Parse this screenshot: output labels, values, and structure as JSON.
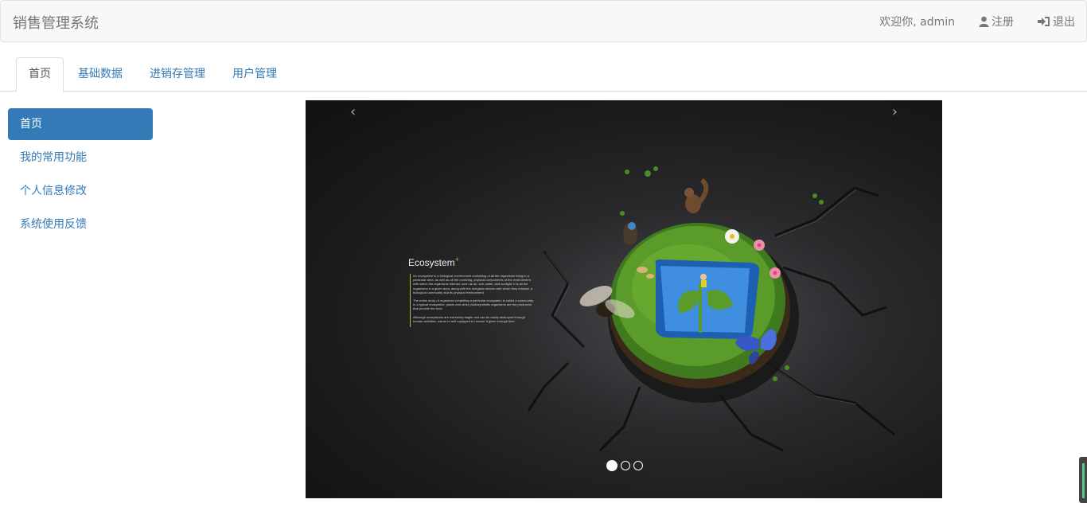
{
  "navbar": {
    "brand": "销售管理系统",
    "welcome": "欢迎你, admin",
    "register_label": "注册",
    "logout_label": "退出",
    "icons": {
      "register": "user-icon",
      "logout": "sign-in-icon"
    }
  },
  "tabs": [
    {
      "label": "首页",
      "active": true
    },
    {
      "label": "基础数据",
      "active": false
    },
    {
      "label": "进销存管理",
      "active": false
    },
    {
      "label": "用户管理",
      "active": false
    }
  ],
  "sidebar": {
    "items": [
      {
        "label": "首页",
        "active": true
      },
      {
        "label": "我的常用功能",
        "active": false
      },
      {
        "label": "个人信息修改",
        "active": false
      },
      {
        "label": "系统使用反馈",
        "active": false
      }
    ]
  },
  "carousel": {
    "prev_label": "‹",
    "next_label": "›",
    "slide": {
      "title": "Ecosystem",
      "title_mark": "+",
      "paragraphs": [
        "An ecosystem is a biological environment consisting of all the organisms living in a particular area, as well as all the nonliving, physical components of the environment with which the organisms interact, such as air, soil, water, and sunlight. It is all the organisms in a given area, along with the inorganic factors with which they interact; a biological community and its physical environment.",
        "The entire array of organisms inhabiting a particular ecosystem is called a community. In a typical ecosystem, plants and other photosynthetic organisms are the producers that provide the food.",
        "Although ecosystems are extremely fragile and can be easily destroyed through human activities, nature is well equipped to recover if given enough time."
      ]
    },
    "indicators": {
      "count": 3,
      "active_index": 0
    }
  },
  "colors": {
    "primary": "#337ab7",
    "navbar_bg": "#f8f8f8",
    "accent_green": "#a9c02a"
  }
}
